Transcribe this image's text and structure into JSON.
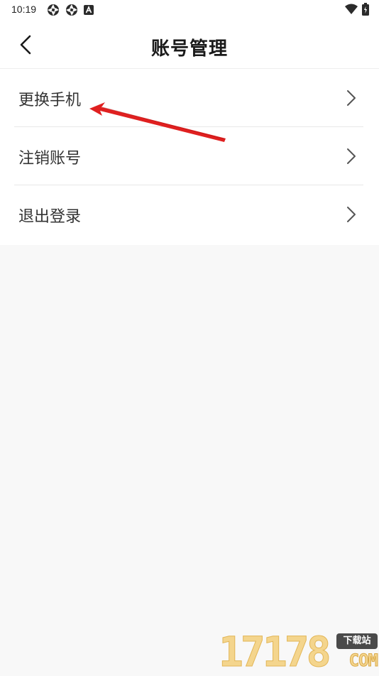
{
  "status_bar": {
    "time": "10:19",
    "left_icons": [
      "aperture-icon",
      "aperture-icon",
      "a-box-icon"
    ],
    "right_icons": [
      "wifi-icon",
      "battery-icon"
    ]
  },
  "header": {
    "title": "账号管理",
    "back_icon": "chevron-left-icon"
  },
  "menu": {
    "items": [
      {
        "label": "更换手机",
        "icon": "chevron-right-icon"
      },
      {
        "label": "注销账号",
        "icon": "chevron-right-icon"
      },
      {
        "label": "退出登录",
        "icon": "chevron-right-icon"
      }
    ]
  },
  "annotation": {
    "color": "#e02020",
    "icon": "red-arrow-annotation"
  },
  "watermark": {
    "number": "17178",
    "badge": "下载站",
    "domain": "COM"
  },
  "colors": {
    "background": "#f8f8f8",
    "surface": "#ffffff",
    "text": "#333333",
    "title": "#1a1a1a"
  }
}
